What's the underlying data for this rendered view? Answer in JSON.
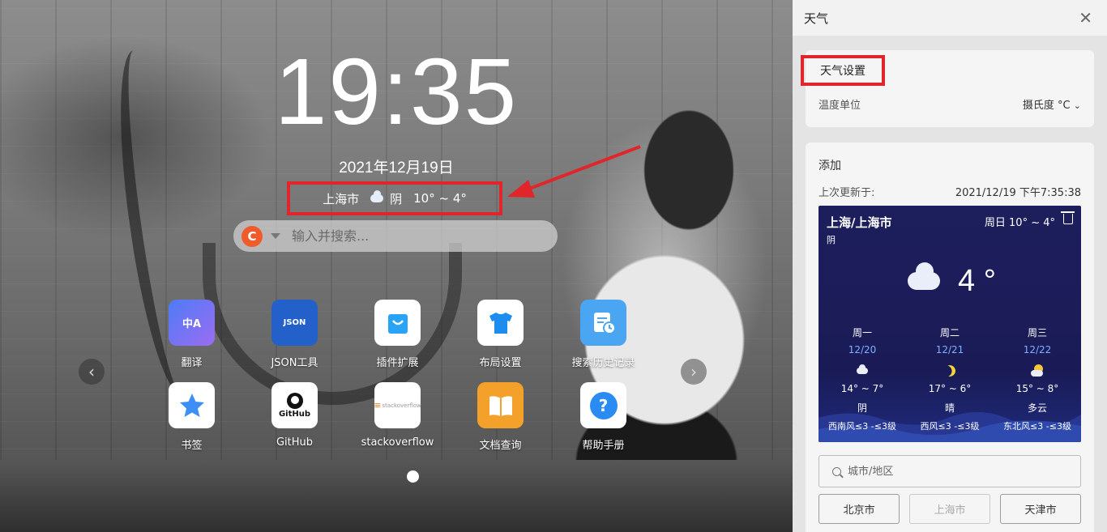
{
  "center": {
    "time": "19:35",
    "date": "2021年12月19日",
    "weather": {
      "city": "上海市",
      "icon": "cloud-icon",
      "condition": "阴",
      "range": "10° ~ 4°"
    },
    "search": {
      "engine_letter": "C",
      "placeholder": "输入并搜索..."
    },
    "apps": [
      {
        "label": "翻译",
        "icon": "translate-icon",
        "glyph": "中A"
      },
      {
        "label": "JSON工具",
        "icon": "json-file-icon",
        "glyph": "JSON"
      },
      {
        "label": "插件扩展",
        "icon": "shopping-bag-icon",
        "glyph": ""
      },
      {
        "label": "布局设置",
        "icon": "tshirt-icon",
        "glyph": ""
      },
      {
        "label": "搜索历史记录",
        "icon": "history-icon",
        "glyph": ""
      },
      {
        "label": "书签",
        "icon": "star-icon",
        "glyph": ""
      },
      {
        "label": "GitHub",
        "icon": "github-icon",
        "glyph": "GitHub"
      },
      {
        "label": "stackoverflow",
        "icon": "stackoverflow-icon",
        "glyph": "stackoverflow"
      },
      {
        "label": "文档查询",
        "icon": "book-icon",
        "glyph": ""
      },
      {
        "label": "帮助手册",
        "icon": "help-icon",
        "glyph": "?"
      }
    ]
  },
  "panel": {
    "title": "天气",
    "settings": {
      "title": "天气设置",
      "unit_label": "温度单位",
      "unit_value": "摄氏度 °C"
    },
    "add": {
      "title": "添加",
      "updated_label": "上次更新于:",
      "updated_value": "2021/12/19 下午7:35:38"
    },
    "card": {
      "city": "上海/上海市",
      "condition": "阴",
      "range": "周日  10° ~ 4°",
      "temp": "4 °",
      "forecast": [
        {
          "day": "周一",
          "date": "12/20",
          "icon": "cloud-icon",
          "range": "14° ~ 7°",
          "condition": "阴",
          "wind": "西南风≤3 -≤3级"
        },
        {
          "day": "周二",
          "date": "12/21",
          "icon": "moon-icon",
          "range": "17° ~ 6°",
          "condition": "晴",
          "wind": "西风≤3 -≤3级"
        },
        {
          "day": "周三",
          "date": "12/22",
          "icon": "partly-cloudy-icon",
          "range": "15° ~ 8°",
          "condition": "多云",
          "wind": "东北风≤3 -≤3级"
        }
      ]
    },
    "city_search_placeholder": "城市/地区",
    "city_buttons": [
      "北京市",
      "上海市",
      "天津市"
    ]
  },
  "colors": {
    "highlight": "#e0262a",
    "card_bg": "#1d1e5c",
    "date_blue": "#7fb0ff"
  }
}
